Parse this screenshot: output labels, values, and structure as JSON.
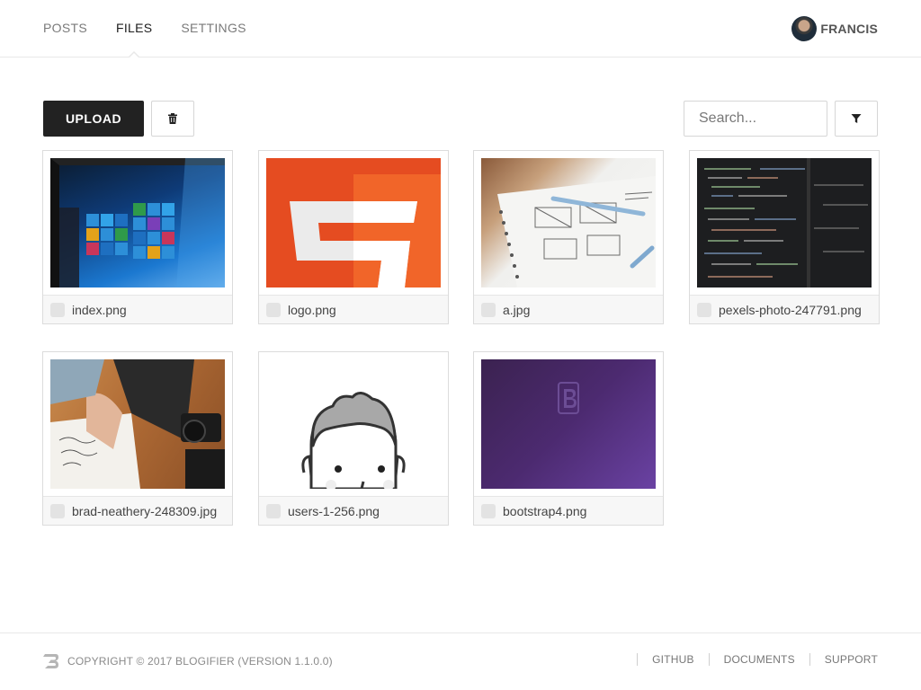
{
  "nav": {
    "items": [
      {
        "label": "POSTS"
      },
      {
        "label": "FILES"
      },
      {
        "label": "SETTINGS"
      }
    ],
    "active": "FILES"
  },
  "user": {
    "name": "FRANCIS"
  },
  "toolbar": {
    "upload_label": "UPLOAD",
    "delete_icon": "trash-icon",
    "search_placeholder": "Search...",
    "search_value": "",
    "filter_icon": "filter-icon"
  },
  "files": [
    {
      "name": "index.png",
      "thumb": "windows-tablet-photo"
    },
    {
      "name": "logo.png",
      "thumb": "html5-logo"
    },
    {
      "name": "a.jpg",
      "thumb": "wireframe-sketch-photo"
    },
    {
      "name": "pexels-photo-247791.png",
      "thumb": "code-screen-photo"
    },
    {
      "name": "brad-neathery-248309.jpg",
      "thumb": "desk-notebook-photo"
    },
    {
      "name": "users-1-256.png",
      "thumb": "user-avatar-illustration"
    },
    {
      "name": "bootstrap4.png",
      "thumb": "bootstrap-logo"
    }
  ],
  "footer": {
    "copyright": "COPYRIGHT © 2017 BLOGIFIER (VERSION 1.1.0.0)",
    "links": [
      "GITHUB",
      "DOCUMENTS",
      "SUPPORT"
    ]
  },
  "colors": {
    "primary_button": "#222222",
    "border": "#dcdcdc",
    "html5_orange": "#e54c21",
    "bootstrap_purple": "#563d7c"
  }
}
